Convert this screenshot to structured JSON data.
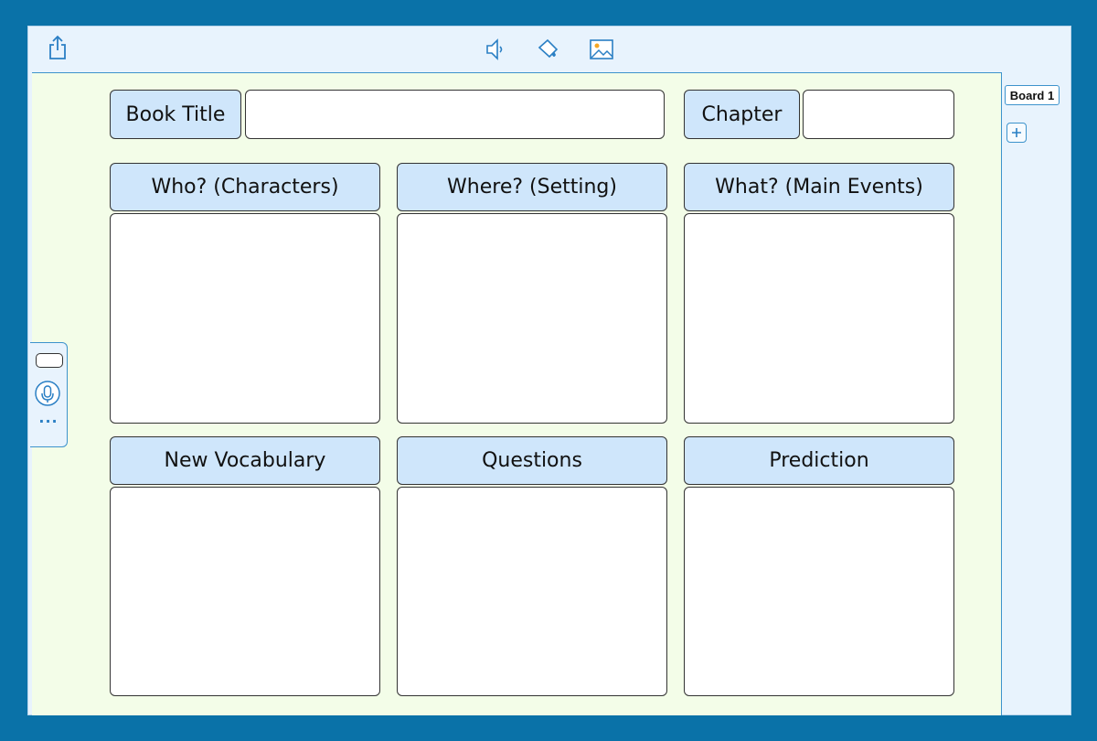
{
  "toolbar": {
    "share_icon": "share-icon",
    "sound_icon": "speaker-icon",
    "fill_icon": "paint-bucket-icon",
    "image_icon": "image-icon"
  },
  "sidebar": {
    "tab_label": "Board 1",
    "add_icon": "plus-icon",
    "dots": "···"
  },
  "header": {
    "book_title_label": "Book Title",
    "chapter_label": "Chapter"
  },
  "sections": [
    {
      "label": "Who? (Characters)"
    },
    {
      "label": "Where? (Setting)"
    },
    {
      "label": "What? (Main Events)"
    },
    {
      "label": "New Vocabulary"
    },
    {
      "label": "Questions"
    },
    {
      "label": "Prediction"
    }
  ],
  "colors": {
    "frame": "#0a72a8",
    "board_bg": "#f3fde8",
    "label_bg": "#cfe6fb",
    "accent": "#2a7fc4"
  }
}
